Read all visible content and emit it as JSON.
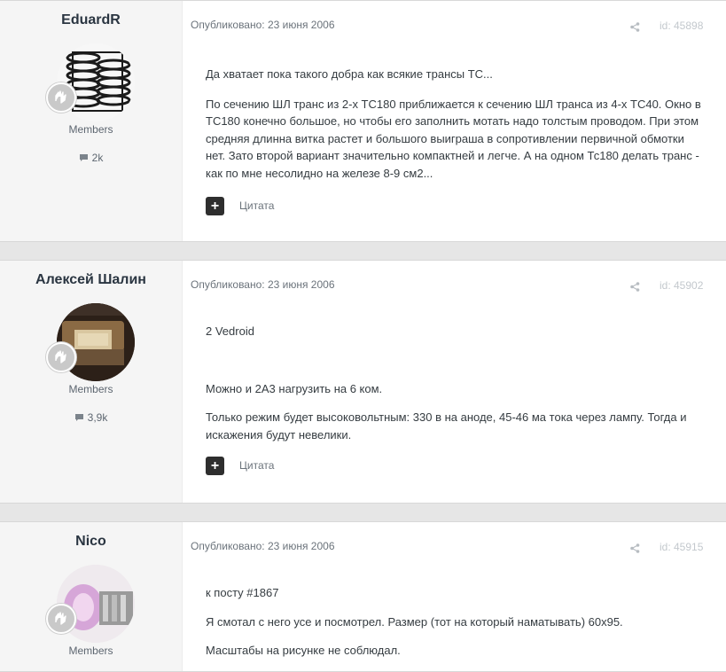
{
  "posts": [
    {
      "author": "EduardR",
      "group": "Members",
      "reputation": "2k",
      "published": "Опубликовано: 23 июня 2006",
      "post_id": "id: 45898",
      "quote_label": "Цитата",
      "paragraphs": [
        "Да хватает пока такого добра как всякие трансы ТС...",
        "По сечению ШЛ транс из 2-х ТС180 приближается к сечению ШЛ транса из 4-х ТС40. Окно в ТС180 конечно большое, но чтобы его заполнить мотать надо толстым проводом. При этом средняя длинна витка растет и большого выиграша в сопротивлении первичной обмотки нет. Зато второй вариант значительно компактней и легче. А на одном Тс180 делать транс - как по мне несолидно на железе 8-9 см2..."
      ]
    },
    {
      "author": "Алексей Шалин",
      "group": "Members",
      "reputation": "3,9k",
      "published": "Опубликовано: 23 июня 2006",
      "post_id": "id: 45902",
      "quote_label": "Цитата",
      "paragraphs": [
        "2 Vedroid",
        "Можно и 2А3 нагрузить на 6 ком.",
        "Только режим будет высоковольтным: 330 в на аноде, 45-46 ма тока через лампу. Тогда и искажения будут невелики."
      ]
    },
    {
      "author": "Nico",
      "group": "Members",
      "published": "Опубликовано: 23 июня 2006",
      "post_id": "id: 45915",
      "paragraphs": [
        "к посту #1867",
        "Я смотал с него усе и посмотрел. Размер (тот на который наматывать) 60х95.",
        "Масштабы на рисунке не соблюдал."
      ]
    }
  ],
  "icons": {
    "share": "share-icon",
    "reputation": "speech-bubble-icon",
    "rank": "rank-badge-icon",
    "quote": "plus-icon"
  },
  "colors": {
    "page_bg": "#e6e6e6",
    "author_panel_bg": "#f5f5f5",
    "quote_button": "#2e2e2e",
    "author_name": "#2a3541"
  }
}
